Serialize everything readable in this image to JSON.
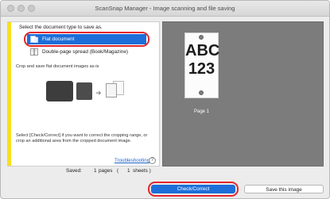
{
  "window": {
    "title": "ScanSnap Manager - Image scanning and file saving"
  },
  "left_panel": {
    "prompt": "Select the document type to save as.",
    "options": [
      {
        "label": "Flat document",
        "selected": true,
        "icon": "flat-document-icon"
      },
      {
        "label": "Double-page spread (Book/Magazine)",
        "selected": false,
        "icon": "double-page-icon"
      }
    ],
    "description": "Crop and save flat document images as-is",
    "check_hint": "Select [Check/Correct] if you want to correct the cropping range, or crop an additional area from the cropped document image.",
    "troubleshooting": "Troubleshooting",
    "help_symbol": "?"
  },
  "status": {
    "saved_label": "Saved:",
    "pages_count": "1",
    "pages_unit": "pages",
    "open_paren": "(",
    "sheets_count": "1",
    "sheets_unit": "sheets )"
  },
  "preview": {
    "thumb_line1": "ABC",
    "thumb_line2": "123",
    "page_label": "Page 1"
  },
  "buttons": {
    "check_correct": "Check/Correct",
    "save_image": "Save this image"
  },
  "colors": {
    "selection_blue": "#1d6ed8",
    "highlight_red": "#e4262c",
    "accent_yellow": "#f7e01c",
    "preview_gray": "#7c7c7c"
  }
}
